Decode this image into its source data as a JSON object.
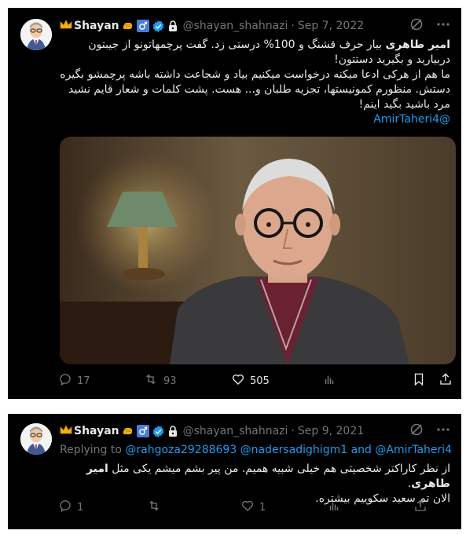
{
  "tweets": [
    {
      "display_name": "Shayan",
      "handle": "@shayan_shahnazi",
      "separator": "·",
      "date": "Sep 7, 2022",
      "text_bold": "امیر طاهری",
      "text_line1": " بیار حرف قشنگ و 100% درستی زد. گفت پرچمهاتونو از جیبتون دربیارید و بگیرید دستتون!",
      "text_line2": "ما هم از هرکی ادعا میکنه درخواست میکنیم بیاد و شجاعت داشته باشه پرچمشو بگیره دستش. منظورم کمونیستها، تجزیه طلبان و... هست. پشت کلمات و شعار قایم نشید مرد باشید بگید اینم!",
      "mention": "@AmirTaheri4",
      "replies": "17",
      "retweets": "93",
      "likes": "505"
    },
    {
      "display_name": "Shayan",
      "handle": "@shayan_shahnazi",
      "separator": "·",
      "date": "Sep 9, 2021",
      "replying_label": "Replying to",
      "replying_to": "@rahgoza29288693 @nadersadighigm1 and @AmirTaheri4",
      "text_line1": "از نظر کاراکتر شخصیتی هم خیلی شبیه همیم. من پیر بشم میشم یکی مثل ",
      "text_bold": "امیر طاهری",
      "text_line1_end": ".",
      "text_line2": "الان تم سعید سکوییم بیشتره.",
      "replies": "1",
      "likes": "1"
    }
  ],
  "colors": {
    "background": "#000000",
    "text": "#e7e9ea",
    "muted": "#71767b",
    "link": "#1d9bf0",
    "verified": "#1d9bf0"
  },
  "icons": [
    "crown-icon",
    "fist-icon",
    "male-sign-icon",
    "verified-badge-icon",
    "lock-icon",
    "grok-icon",
    "more-icon",
    "reply-icon",
    "retweet-icon",
    "like-icon",
    "views-icon",
    "bookmark-icon",
    "share-icon"
  ]
}
